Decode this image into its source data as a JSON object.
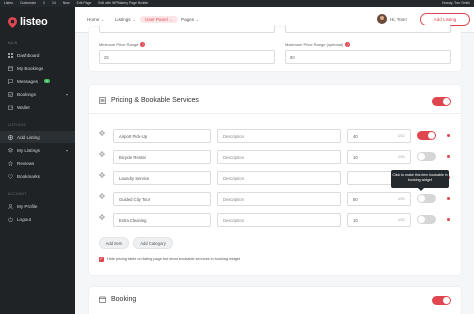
{
  "adminbar": {
    "items": [
      "Listeo",
      "Customize",
      "2",
      "14",
      "New",
      "Edit Page",
      "Edit with WPBakery Page Builder"
    ],
    "howdy": "Howdy, Tom Smith"
  },
  "brand": {
    "name": "listeo",
    "accent": "#e0464f"
  },
  "sidebar": {
    "sections": [
      {
        "title": "MAIN",
        "items": [
          {
            "label": "Dashboard",
            "icon": "dashboard-icon"
          },
          {
            "label": "My Bookings",
            "icon": "calendar-icon"
          },
          {
            "label": "Messages",
            "icon": "chat-icon",
            "badge": "2"
          },
          {
            "label": "Bookings",
            "icon": "bookings-icon",
            "caret": "▾"
          },
          {
            "label": "Wallet",
            "icon": "wallet-icon"
          }
        ]
      },
      {
        "title": "LISTINGS",
        "items": [
          {
            "label": "Add Listing",
            "icon": "add-icon"
          },
          {
            "label": "My Listings",
            "icon": "layers-icon",
            "caret": "▾"
          },
          {
            "label": "Reviews",
            "icon": "star-icon"
          },
          {
            "label": "Bookmarks",
            "icon": "heart-icon"
          }
        ]
      },
      {
        "title": "ACCOUNT",
        "items": [
          {
            "label": "My Profile",
            "icon": "user-icon"
          },
          {
            "label": "Logout",
            "icon": "power-icon"
          }
        ]
      }
    ]
  },
  "header": {
    "nav": [
      {
        "label": "Home",
        "chev": "⌄"
      },
      {
        "label": "Listings",
        "chev": "⌄"
      },
      {
        "label": "User Panel",
        "chev": "⌄"
      },
      {
        "label": "Pages",
        "chev": "⌄"
      }
    ],
    "greeting": "Hi, Tom!",
    "add_listing": "Add Listing"
  },
  "pricing": {
    "min_label": "Minimum Price Range",
    "max_label": "Maximum Price Range (optional)",
    "min_value": "25",
    "max_value": "80"
  },
  "services": {
    "title": "Pricing & Bookable Services",
    "desc_placeholder": "Description",
    "currency": "USD",
    "rows": [
      {
        "name": "Airport Pick-Up",
        "price": "40",
        "on": true
      },
      {
        "name": "Bicycle Rental",
        "price": "10",
        "on": false
      },
      {
        "name": "Laundry Service",
        "price": "",
        "on": false
      },
      {
        "name": "Guided City Tour",
        "price": "50",
        "on": false
      },
      {
        "name": "Extra Cleaning",
        "price": "10",
        "on": false
      }
    ],
    "tooltip": "Click to make this item bookable in booking widget",
    "add_item": "Add Item",
    "add_category": "Add Category",
    "hide_label": "Hide pricing table on listing page but show bookable services in booking widget"
  },
  "booking": {
    "title": "Booking"
  }
}
